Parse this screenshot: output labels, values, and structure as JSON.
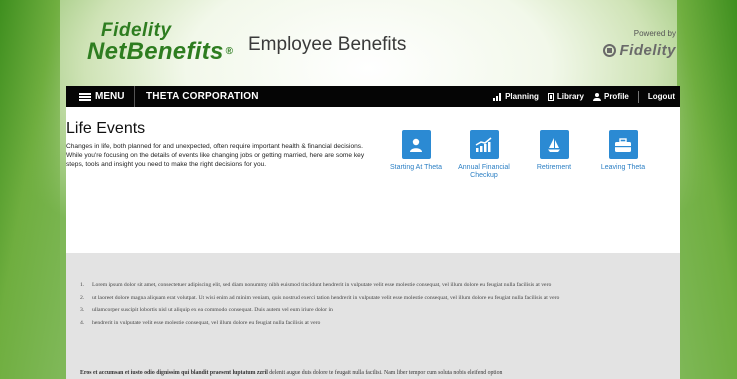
{
  "brand": {
    "logo_line1": "Fidelity",
    "logo_line2": "NetBenefits",
    "logo_reg": "®",
    "app_title": "Employee Benefits",
    "powered_by": "Powered by",
    "fidelity_wordmark": "Fidelity"
  },
  "navbar": {
    "menu_label": "MENU",
    "company_name": "THETA CORPORATION",
    "links": [
      {
        "label": "Planning",
        "icon": "bar-chart-icon"
      },
      {
        "label": "Library",
        "icon": "book-icon"
      },
      {
        "label": "Profile",
        "icon": "person-icon"
      }
    ],
    "logout_label": "Logout"
  },
  "main": {
    "heading": "Life Events",
    "intro": "Changes in life, both planned for and unexpected, often require important health & financial decisions. While you're focusing on the details of events like changing jobs or getting married, here are some key steps, tools and insight you need to make the right decisions for you.",
    "tiles": [
      {
        "label": "Starting At Theta",
        "icon": "person-icon"
      },
      {
        "label": "Annual Financial Checkup",
        "icon": "growth-chart-icon"
      },
      {
        "label": "Retirement",
        "icon": "sailboat-icon"
      },
      {
        "label": "Leaving Theta",
        "icon": "briefcase-icon"
      }
    ]
  },
  "footer": {
    "items": [
      {
        "num": "1.",
        "text": "Lorem ipsum dolor sit amet, consectetuer adipiscing elit, sed diam nonummy nibh euismod tincidunt hendrerit in vulputate velit esse molestie consequat, vel illum dolore eu feugiat nulla facilisis at vero"
      },
      {
        "num": "2.",
        "text": "ut laoreet dolore magna aliquam erat volutpat. Ut wisi enim ad minim veniam, quis nostrud exerci tation hendrerit in vulputate velit esse molestie consequat, vel illum dolore eu feugiat nulla facilisis at vero"
      },
      {
        "num": "3.",
        "text": "ullamcorper suscipit lobortis nisl ut aliquip ex ea commodo consequat. Duis autem vel eum iriure dolor in"
      },
      {
        "num": "4.",
        "text": "hendrerit in vulputate velit esse molestie consequat, vel illum dolore eu feugiat nulla facilisis at vero"
      }
    ],
    "para_bold": "Eros et accumsan et iusto odio dignissim qui blandit praesent luptatum zzril",
    "para_rest": " delenit augue duis dolore te feugait nulla facilisi. Nam liber tempor cum soluta nobis eleifend option"
  },
  "colors": {
    "brand_green": "#2e7d20",
    "nav_bg": "#050505",
    "tile_blue": "#2b8ad3",
    "footer_bg": "#e3e3e3"
  }
}
